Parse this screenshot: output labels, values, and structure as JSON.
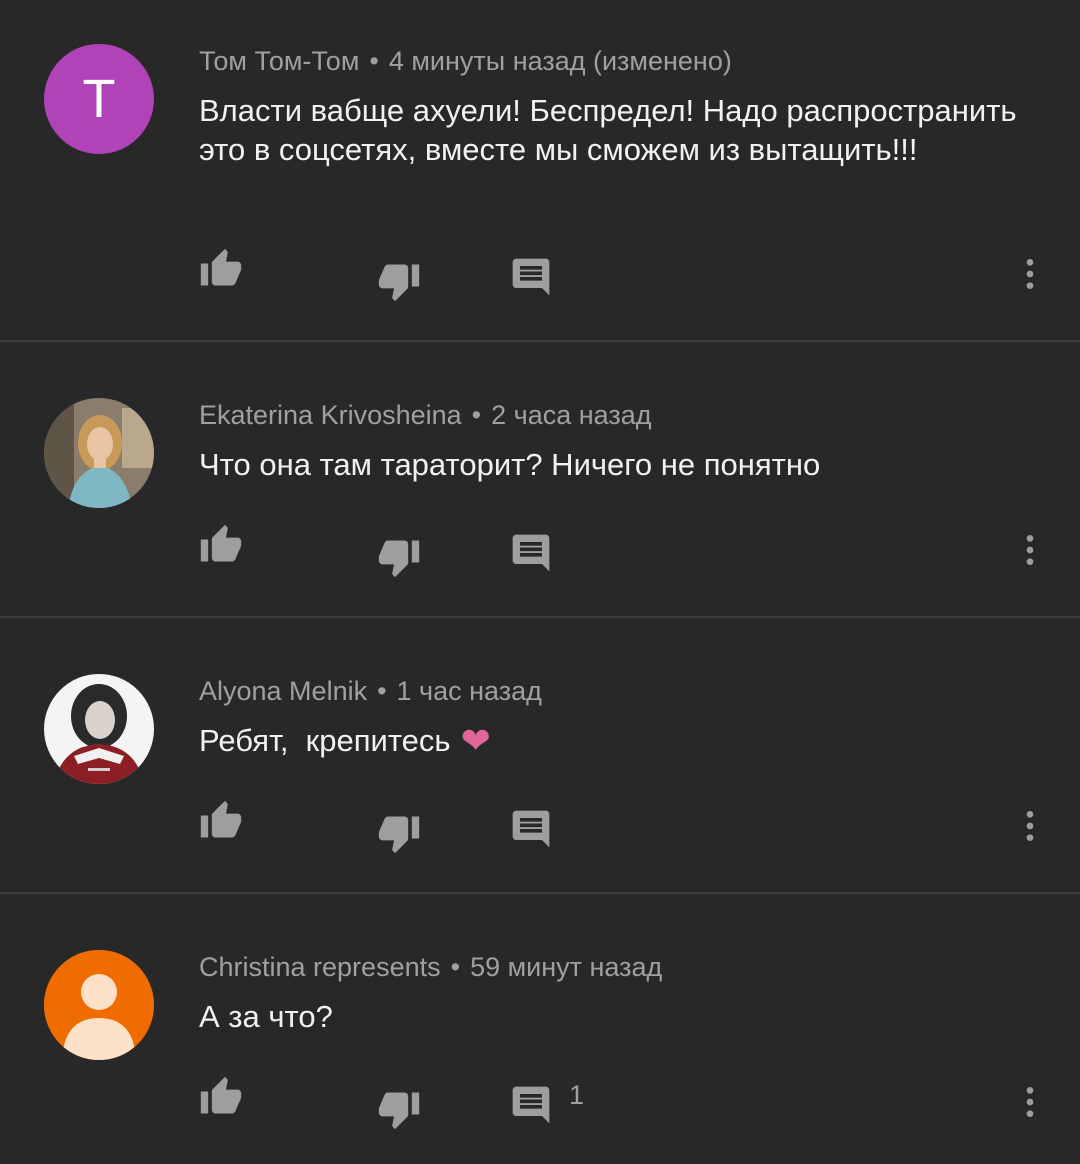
{
  "comments": [
    {
      "avatar_letter": "T",
      "avatar_color": "#b143b8",
      "author": "Том Том-Том",
      "time": "4 минуты назад (изменено)",
      "text": "Власти вабще ахуели! Беспредел! Надо распространить это в соцсетях, вместе мы сможем из вытащить!!!"
    },
    {
      "author": "Ekaterina Krivosheina",
      "time": "2 часа назад",
      "text": "Что она там тараторит? Ничего не понятно"
    },
    {
      "author": "Alyona Melnik",
      "time": "1 час назад",
      "text": "Ребят,  крепитесь",
      "emoji": "❤"
    },
    {
      "avatar_color": "#ef6c00",
      "author": "Christina represents",
      "time": "59 минут назад",
      "text": "А за что?",
      "reply_count": "1"
    }
  ],
  "separator": "•",
  "icons": {
    "like": "thumb-up-icon",
    "dislike": "thumb-down-icon",
    "reply": "comment-icon",
    "more": "more-vert-icon"
  }
}
